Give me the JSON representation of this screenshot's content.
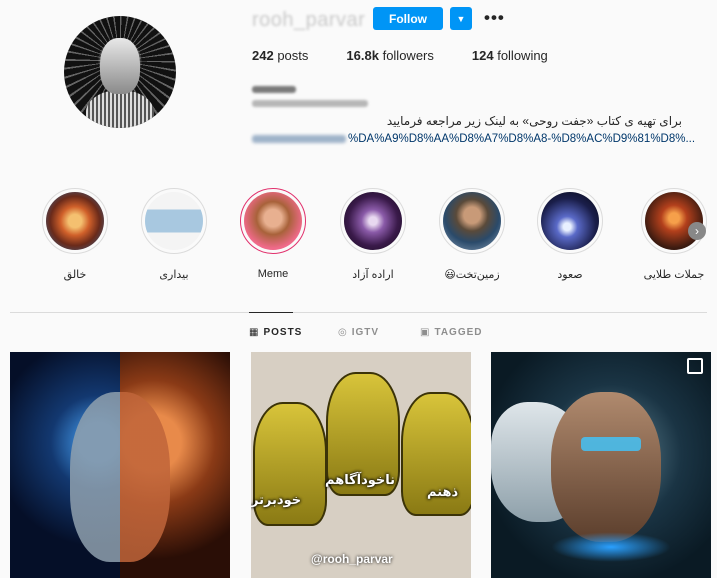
{
  "profile": {
    "username": "rooh_parvar",
    "follow_label": "Follow",
    "more_label": "•••",
    "stats": {
      "posts_value": "242",
      "posts_label": "posts",
      "followers_value": "16.8k",
      "followers_label": "followers",
      "following_value": "124",
      "following_label": "following"
    },
    "bio_text": "برای تهیه ی کتاب «جفت روحی» به لینک زیر مراجعه فرمایید",
    "bio_link": "%DA%A9%D8%AA%D8%A7%D8%A8-%D8%AC%D9%81%D8%..."
  },
  "highlights": [
    {
      "label": "جملات طلایی",
      "color": "#c8562a"
    },
    {
      "label": "صعود",
      "color": "#2a3f8f"
    },
    {
      "label": "😃زمین‌تخت",
      "color": "#6a7a4a"
    },
    {
      "label": "اراده آزاد",
      "color": "#5a3a6a"
    },
    {
      "label": "Meme",
      "color": "#c87a4a"
    },
    {
      "label": "بیداری",
      "color": "#8aa8c8"
    },
    {
      "label": "خالق",
      "color": "#d08a3a"
    }
  ],
  "tabs": [
    {
      "label": "POSTS",
      "icon": "grid-icon",
      "active": true
    },
    {
      "label": "IGTV",
      "icon": "igtv-icon",
      "active": false
    },
    {
      "label": "TAGGED",
      "icon": "tagged-icon",
      "active": false
    }
  ],
  "posts": {
    "post2": {
      "text1": "ناخودآگاهم",
      "text2": "خودبرتر",
      "text3": "ذهنم",
      "handle": "@rooh_parvar"
    }
  },
  "colors": {
    "accent": "#0095f6",
    "link": "#00376b",
    "muted": "#8e8e8e",
    "border": "#dbdbdb"
  }
}
